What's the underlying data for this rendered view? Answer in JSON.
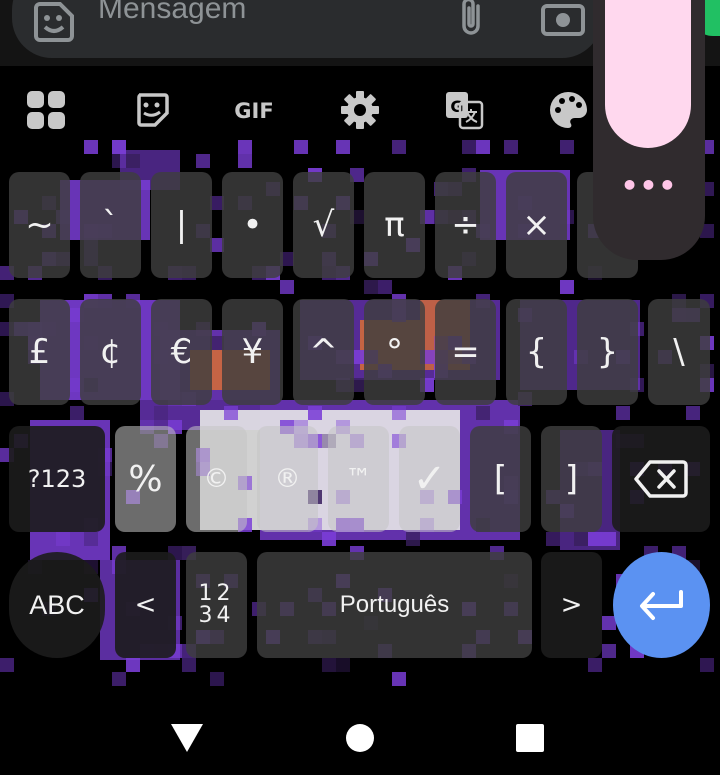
{
  "compose": {
    "placeholder": "Mensagem"
  },
  "toolbar": {
    "items": [
      {
        "name": "apps-grid-icon"
      },
      {
        "name": "sticker-icon"
      },
      {
        "name": "gif",
        "label": "GIF"
      },
      {
        "name": "settings-icon"
      },
      {
        "name": "translate-icon"
      },
      {
        "name": "palette-icon"
      }
    ]
  },
  "floating_panel": {
    "dots": "•••"
  },
  "keyboard": {
    "row1": [
      "~",
      "`",
      "|",
      "•",
      "√",
      "π",
      "÷",
      "×",
      "§"
    ],
    "row2": [
      "£",
      "¢",
      "€",
      "¥",
      "^",
      "°",
      "=",
      "{",
      "}",
      "\\"
    ],
    "row3": {
      "mode": "?123",
      "keys": [
        "%",
        "©",
        "®",
        "™",
        "✓",
        "[",
        "]"
      ]
    },
    "row4": {
      "abc": "ABC",
      "less": "<",
      "num_top": "12",
      "num_bottom": "34",
      "space": "Português",
      "greater": ">"
    }
  },
  "colors": {
    "background": "#000000",
    "key": "#3e3e3e",
    "enter": "#5b92f2",
    "float_pill": "#ffd8ee",
    "accent_purple": "#7a3dd6",
    "accent_orange": "#d06a3a"
  }
}
